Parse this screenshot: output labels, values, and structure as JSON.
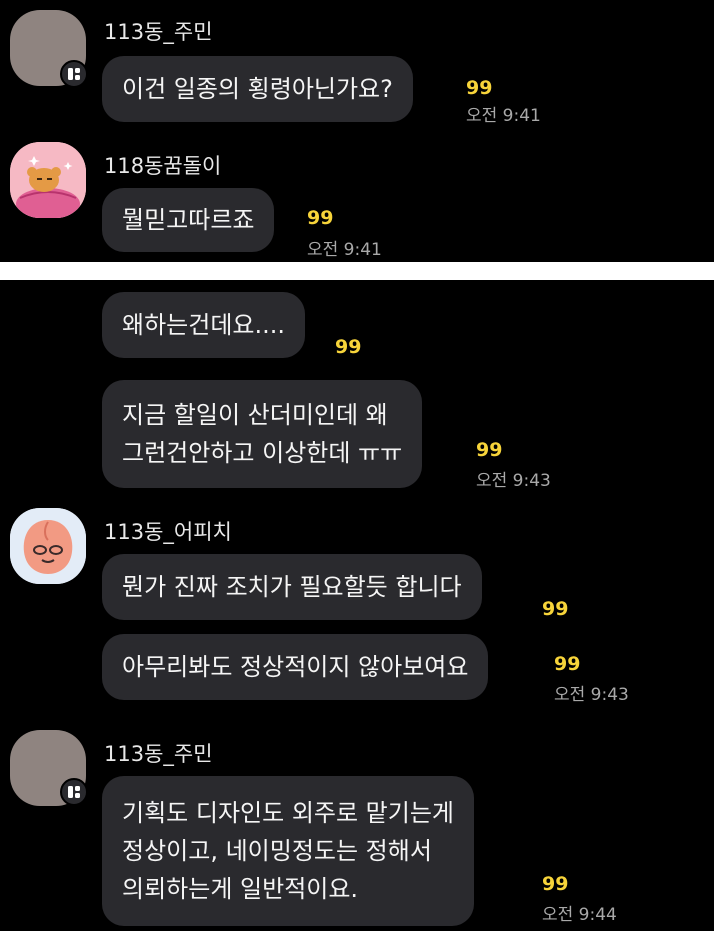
{
  "top_panel": {
    "messages": [
      {
        "sender": "113동_주민",
        "text": "이건 일종의 횡령아닌가요?",
        "unread": "99",
        "time": "오전 9:41"
      },
      {
        "sender": "118동꿈돌이",
        "text": "뭘믿고따르죠",
        "unread": "99",
        "time": "오전 9:41"
      }
    ]
  },
  "bottom_panel": {
    "messages": [
      {
        "text": "왜하는건데요....",
        "unread": "99"
      },
      {
        "lines": [
          "지금 할일이 산더미인데 왜",
          "그런건안하고 이상한데 ㅠㅠ"
        ],
        "unread": "99",
        "time": "오전 9:43"
      },
      {
        "sender": "113동_어피치",
        "text": "뭔가 진짜 조치가 필요할듯 합니다",
        "unread": "99"
      },
      {
        "text": "아무리봐도 정상적이지 않아보여요",
        "unread": "99",
        "time": "오전 9:43"
      },
      {
        "sender": "113동_주민",
        "lines": [
          "기획도 디자인도 외주로 맡기는게",
          "정상이고, 네이밍정도는 정해서",
          "의뢰하는게 일반적이요."
        ],
        "unread": "99",
        "time": "오전 9:44"
      }
    ]
  },
  "colors": {
    "background": "#000000",
    "bubble": "#2a2a2e",
    "unread": "#f7d43a",
    "time": "#a9a9a9",
    "divider": "#ffffff"
  }
}
